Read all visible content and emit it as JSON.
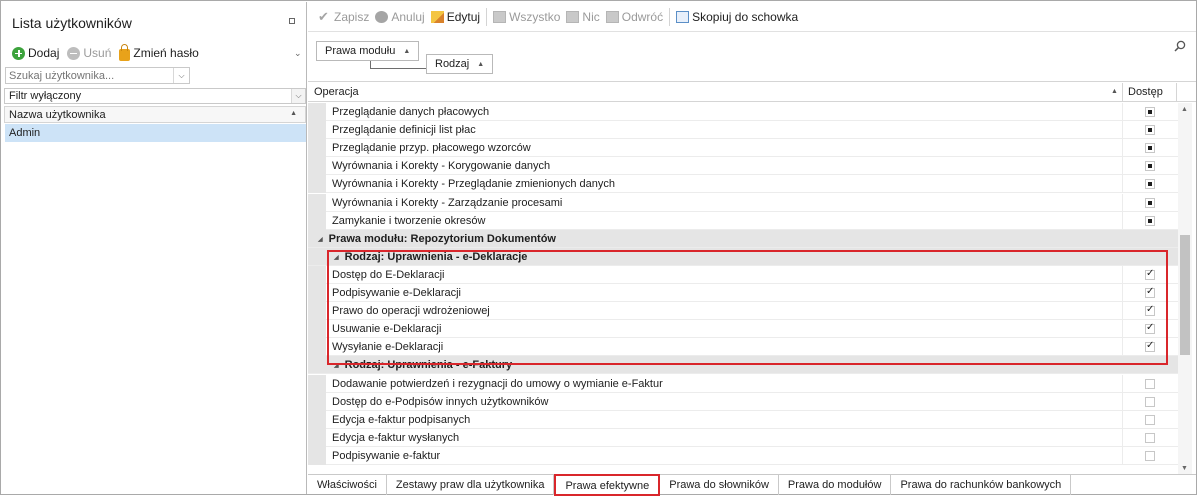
{
  "left_panel": {
    "title": "Lista użytkowników",
    "toolbar": {
      "add": "Dodaj",
      "delete": "Usuń",
      "change_password": "Zmień hasło"
    },
    "search_placeholder": "Szukaj użytkownika...",
    "filter": "Filtr wyłączony",
    "column_header": "Nazwa użytkownika",
    "users": [
      "Admin"
    ]
  },
  "toolbar": {
    "save": "Zapisz",
    "cancel": "Anuluj",
    "edit": "Edytuj",
    "all": "Wszystko",
    "none": "Nic",
    "invert": "Odwróć",
    "copy": "Skopiuj do schowka"
  },
  "grouping": {
    "chip1": "Prawa modułu",
    "chip2": "Rodzaj"
  },
  "grid": {
    "col_operation": "Operacja",
    "col_access": "Dostęp",
    "rows_top": [
      {
        "text": "Przeglądanie danych płacowych",
        "state": "filled"
      },
      {
        "text": "Przeglądanie definicji list płac",
        "state": "filled"
      },
      {
        "text": "Przeglądanie przyp. płacowego wzorców",
        "state": "filled"
      },
      {
        "text": "Wyrównania i Korekty - Korygowanie danych",
        "state": "filled"
      },
      {
        "text": "Wyrównania i Korekty - Przeglądanie zmienionych danych",
        "state": "filled"
      },
      {
        "text": "Wyrównania i Korekty - Zarządzanie procesami",
        "state": "filled"
      },
      {
        "text": "Zamykanie i tworzenie okresów",
        "state": "filled"
      }
    ],
    "group_module": "Prawa modułu: Repozytorium Dokumentów",
    "group_edeklaracje": "Rodzaj: Uprawnienia - e-Deklaracje",
    "rows_edeklaracje": [
      {
        "text": "Dostęp do E-Deklaracji",
        "state": "checked"
      },
      {
        "text": "Podpisywanie e-Deklaracji",
        "state": "checked"
      },
      {
        "text": "Prawo do operacji wdrożeniowej",
        "state": "checked"
      },
      {
        "text": "Usuwanie e-Deklaracji",
        "state": "checked"
      },
      {
        "text": "Wysyłanie e-Deklaracji",
        "state": "checked"
      }
    ],
    "group_efaktury": "Rodzaj: Uprawnienia - e-Faktury",
    "rows_efaktury": [
      {
        "text": "Dodawanie potwierdzeń i rezygnacji do umowy o wymianie e-Faktur",
        "state": "empty"
      },
      {
        "text": "Dostęp do e-Podpisów innych użytkowników",
        "state": "empty"
      },
      {
        "text": "Edycja e-faktur podpisanych",
        "state": "empty"
      },
      {
        "text": "Edycja e-faktur wysłanych",
        "state": "empty"
      },
      {
        "text": "Podpisywanie e-faktur",
        "state": "empty"
      }
    ]
  },
  "tabs": [
    {
      "label": "Właściwości",
      "active": false
    },
    {
      "label": "Zestawy praw dla użytkownika",
      "active": false
    },
    {
      "label": "Prawa efektywne",
      "active": true
    },
    {
      "label": "Prawa do słowników",
      "active": false
    },
    {
      "label": "Prawa do modułów",
      "active": false
    },
    {
      "label": "Prawa do rachunków bankowych",
      "active": false
    }
  ],
  "colors": {
    "highlight_red": "#d9262b",
    "selection_blue": "#cde3f7",
    "group_gray": "#e5e5e5"
  }
}
